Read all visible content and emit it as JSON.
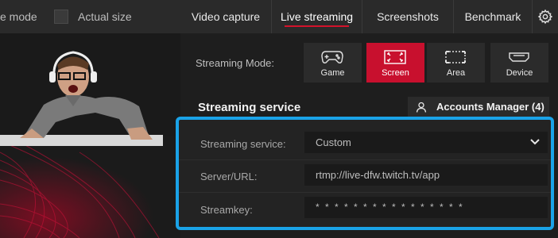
{
  "preview": {
    "mode_label": "e mode",
    "actual_size_label": "Actual size"
  },
  "tabs": [
    {
      "label": "Video capture",
      "active": false
    },
    {
      "label": "Live streaming",
      "active": true
    },
    {
      "label": "Screenshots",
      "active": false
    },
    {
      "label": "Benchmark",
      "active": false
    }
  ],
  "streaming_mode": {
    "label": "Streaming Mode:",
    "options": [
      {
        "label": "Game",
        "icon": "gamepad-icon",
        "active": false
      },
      {
        "label": "Screen",
        "icon": "screen-corners-icon",
        "active": true
      },
      {
        "label": "Area",
        "icon": "area-dashed-icon",
        "active": false
      },
      {
        "label": "Device",
        "icon": "hdmi-device-icon",
        "active": false
      }
    ]
  },
  "streaming_service_section": {
    "title": "Streaming service",
    "accounts_button": "Accounts Manager (4)",
    "fields": {
      "service_label": "Streaming service:",
      "service_value": "Custom",
      "server_label": "Server/URL:",
      "server_value": "rtmp://live-dfw.twitch.tv/app",
      "key_label": "Streamkey:",
      "key_value": "* * * * * * * * * * * * * * * *"
    }
  },
  "colors": {
    "accent_red": "#c8102e",
    "highlight_blue": "#1aa3e8",
    "panel_bg": "#1e1e1e",
    "tabbar_bg": "#2a2a2a"
  }
}
